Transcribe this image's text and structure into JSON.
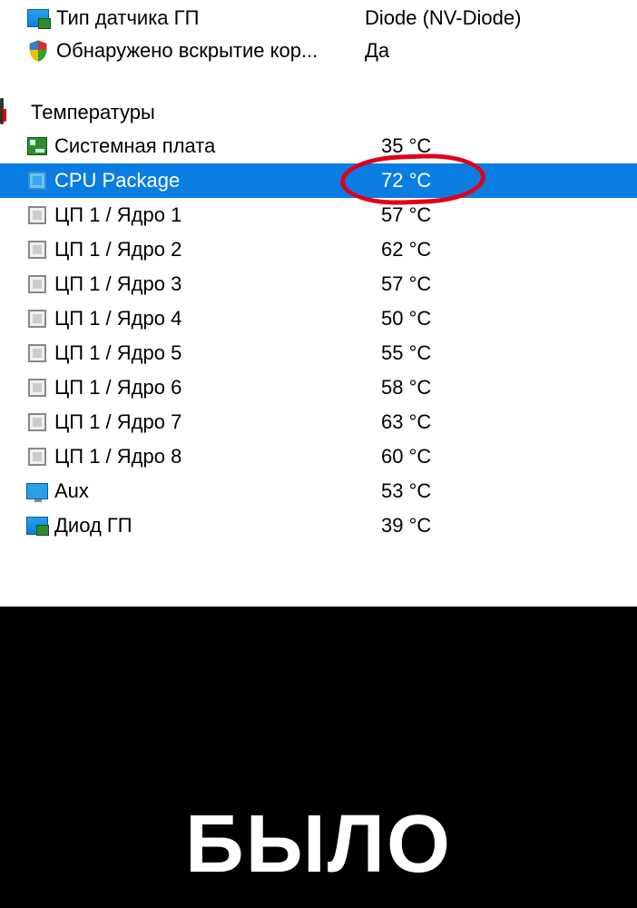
{
  "info": [
    {
      "icon": "monitor-chip-icon",
      "label": "Тип датчика ГП",
      "value": "Diode  (NV-Diode)"
    },
    {
      "icon": "shield-icon",
      "label": "Обнаружено вскрытие кор...",
      "value": "Да"
    }
  ],
  "section": {
    "title": "Температуры"
  },
  "temps": [
    {
      "icon": "motherboard-icon",
      "label": "Системная плата",
      "value": "35 °C",
      "selected": false
    },
    {
      "icon": "chip-icon",
      "label": "CPU Package",
      "value": "72 °C",
      "selected": true,
      "circled": true
    },
    {
      "icon": "chip-icon",
      "label": "ЦП 1 / Ядро 1",
      "value": "57 °C",
      "selected": false
    },
    {
      "icon": "chip-icon",
      "label": "ЦП 1 / Ядро 2",
      "value": "62 °C",
      "selected": false
    },
    {
      "icon": "chip-icon",
      "label": "ЦП 1 / Ядро 3",
      "value": "57 °C",
      "selected": false
    },
    {
      "icon": "chip-icon",
      "label": "ЦП 1 / Ядро 4",
      "value": "50 °C",
      "selected": false
    },
    {
      "icon": "chip-icon",
      "label": "ЦП 1 / Ядро 5",
      "value": "55 °C",
      "selected": false
    },
    {
      "icon": "chip-icon",
      "label": "ЦП 1 / Ядро 6",
      "value": "58 °C",
      "selected": false
    },
    {
      "icon": "chip-icon",
      "label": "ЦП 1 / Ядро 7",
      "value": "63 °C",
      "selected": false
    },
    {
      "icon": "chip-icon",
      "label": "ЦП 1 / Ядро 8",
      "value": "60 °C",
      "selected": false
    },
    {
      "icon": "monitor-icon",
      "label": "Aux",
      "value": "53 °C",
      "selected": false
    },
    {
      "icon": "gpu-icon",
      "label": "Диод ГП",
      "value": "39 °C",
      "selected": false
    }
  ],
  "caption": "БЫЛО"
}
